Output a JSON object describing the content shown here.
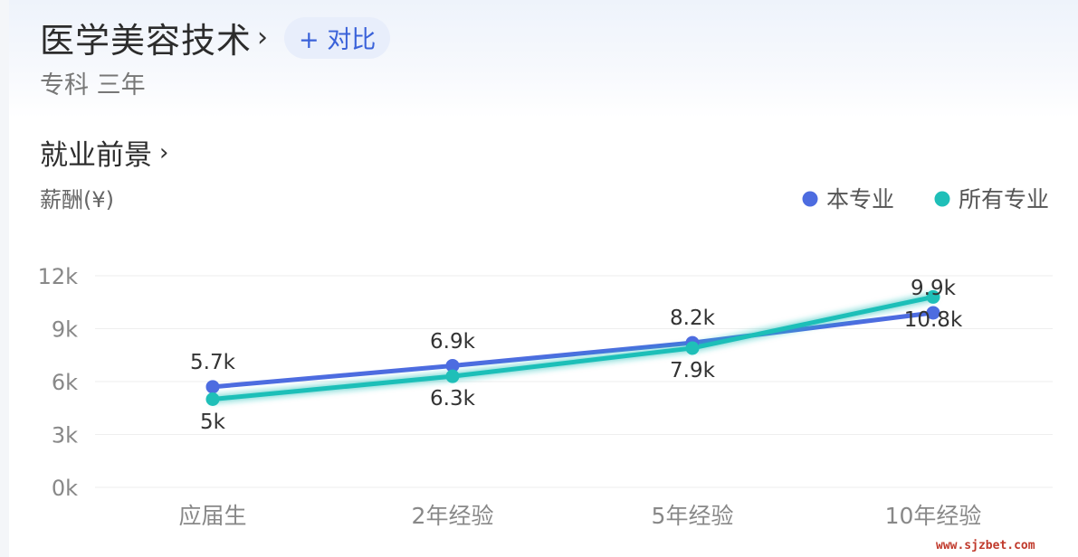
{
  "header": {
    "title": "医学美容技术",
    "compare_label": "+ 对比",
    "subtitle": "专科 三年"
  },
  "section": {
    "title": "就业前景"
  },
  "watermark": "www.sjzbet.com",
  "colors": {
    "this_major": "#4d6ce0",
    "all_majors": "#1fbfb8",
    "grid": "#eeeeee",
    "axis_text": "#888888"
  },
  "chart_data": {
    "type": "line",
    "ylabel": "薪酬(¥)",
    "categories": [
      "应届生",
      "2年经验",
      "5年经验",
      "10年经验"
    ],
    "yticks": [
      "0k",
      "3k",
      "6k",
      "9k",
      "12k"
    ],
    "ylim": [
      0,
      12000
    ],
    "legend_position": "top-right",
    "grid": true,
    "series": [
      {
        "name": "本专业",
        "values": [
          5700,
          6900,
          8200,
          9900
        ],
        "labels": [
          "5.7k",
          "6.9k",
          "8.2k",
          "9.9k"
        ]
      },
      {
        "name": "所有专业",
        "values": [
          5000,
          6300,
          7900,
          10800
        ],
        "labels": [
          "5k",
          "6.3k",
          "7.9k",
          "10.8k"
        ]
      }
    ]
  }
}
